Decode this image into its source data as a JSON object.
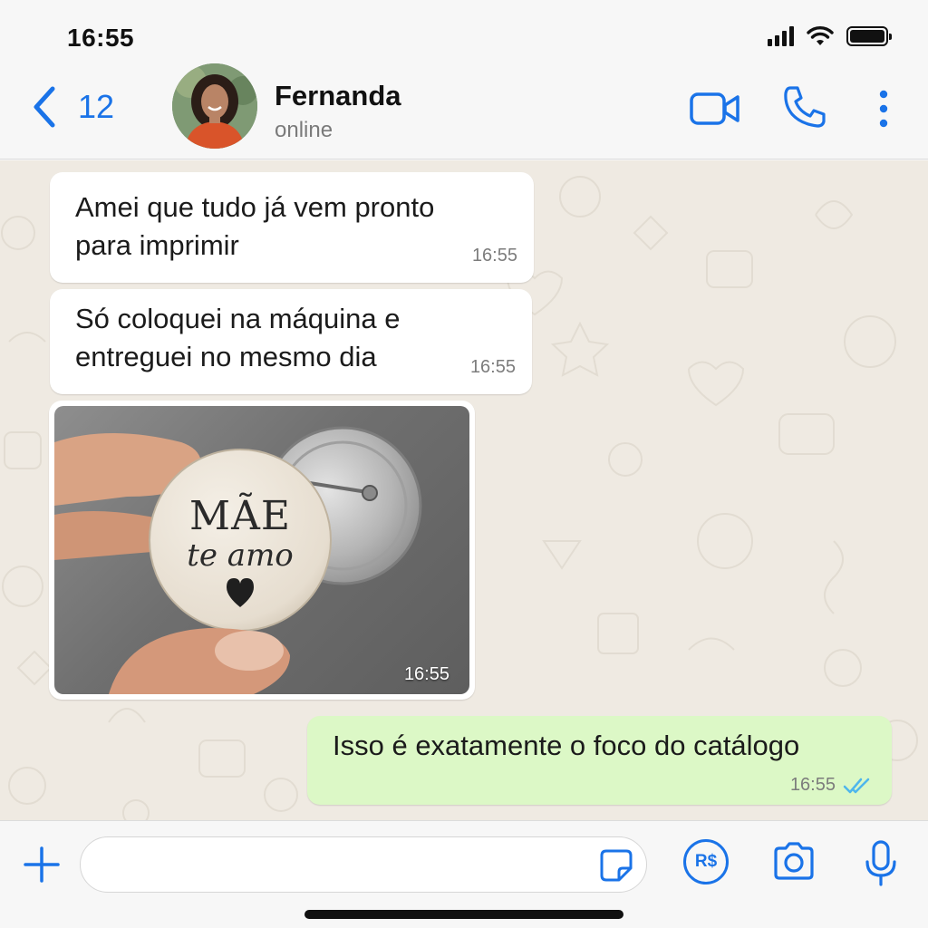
{
  "status_bar": {
    "time": "16:55",
    "icons": [
      "signal-icon",
      "wifi-icon",
      "battery-icon"
    ]
  },
  "header": {
    "back_count": "12",
    "contact_name": "Fernanda",
    "contact_status": "online",
    "icons": [
      "chevron-left-icon",
      "video-call-icon",
      "phone-icon",
      "more-vertical-icon"
    ],
    "accent_color": "#1a73e8"
  },
  "messages": [
    {
      "direction": "incoming",
      "type": "text",
      "text": "Amei que tudo já vem pronto para imprimir",
      "time": "16:55"
    },
    {
      "direction": "incoming",
      "type": "text",
      "text": "Só coloquei na máquina e entreguei no mesmo dia",
      "time": "16:55"
    },
    {
      "direction": "incoming",
      "type": "image",
      "image_text_line1": "MÃE",
      "image_text_line2": "te amo",
      "time": "16:55"
    },
    {
      "direction": "outgoing",
      "type": "text",
      "text": "Isso é exatamente o foco do catálogo",
      "time": "16:55",
      "status": "read"
    }
  ],
  "colors": {
    "incoming_bubble": "#ffffff",
    "outgoing_bubble": "#dcf8c6",
    "chat_background": "#efeae2",
    "read_ticks": "#4fb6ec"
  },
  "input_bar": {
    "placeholder": "",
    "payment_label": "R$",
    "icons": [
      "plus-icon",
      "sticker-icon",
      "payment-icon",
      "camera-icon",
      "microphone-icon"
    ]
  }
}
